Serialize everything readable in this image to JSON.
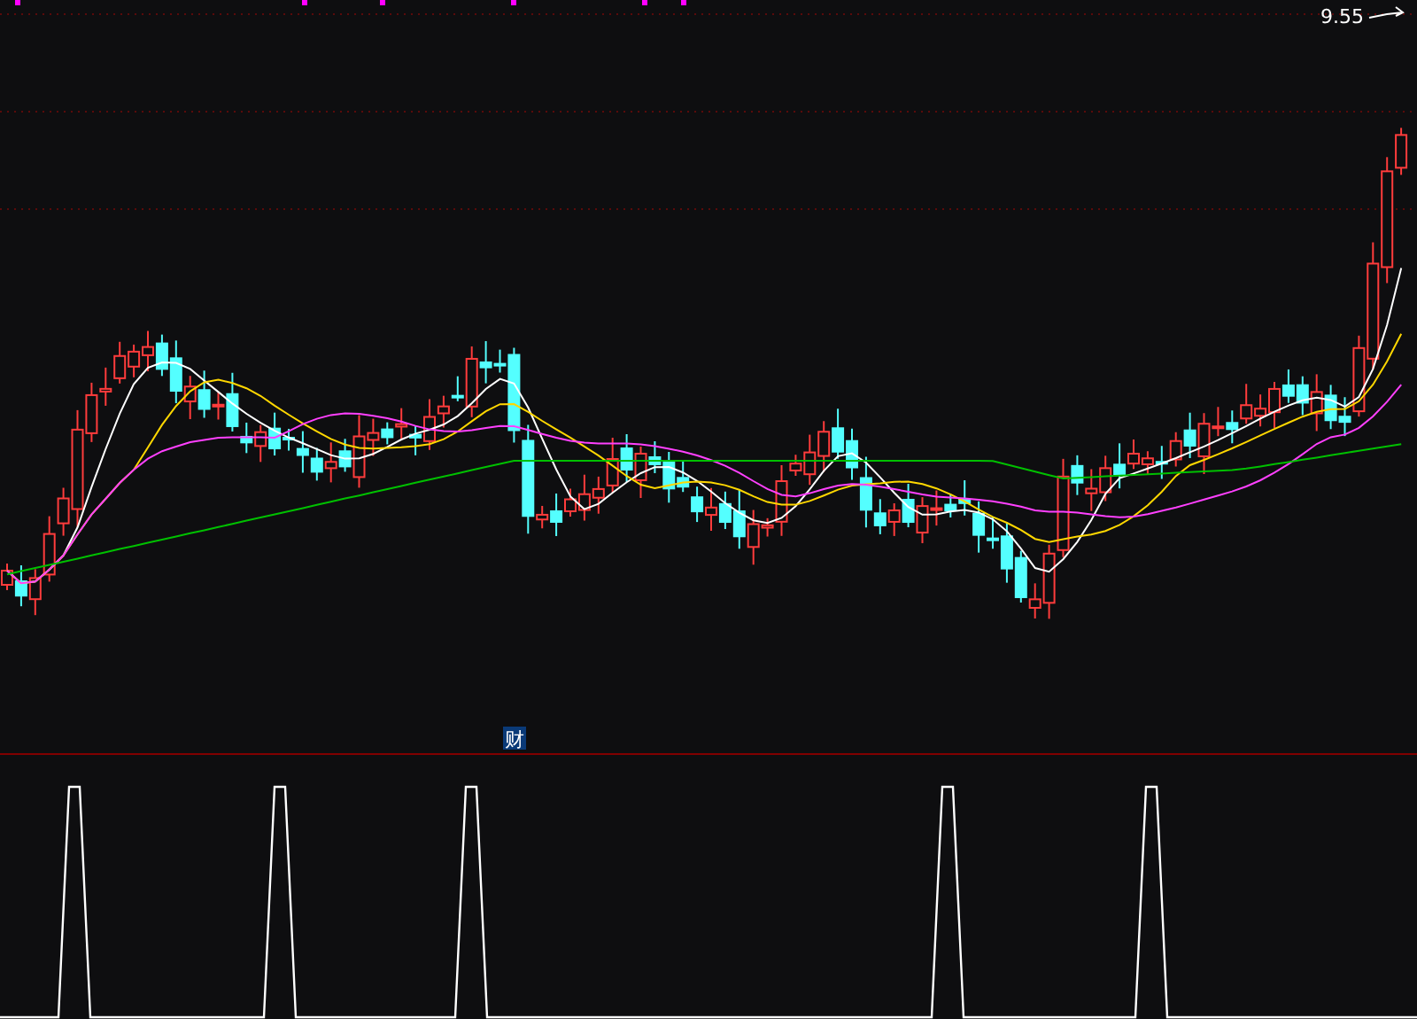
{
  "price_chart": {
    "high_label": "9.55",
    "event_marker": "财"
  }
}
